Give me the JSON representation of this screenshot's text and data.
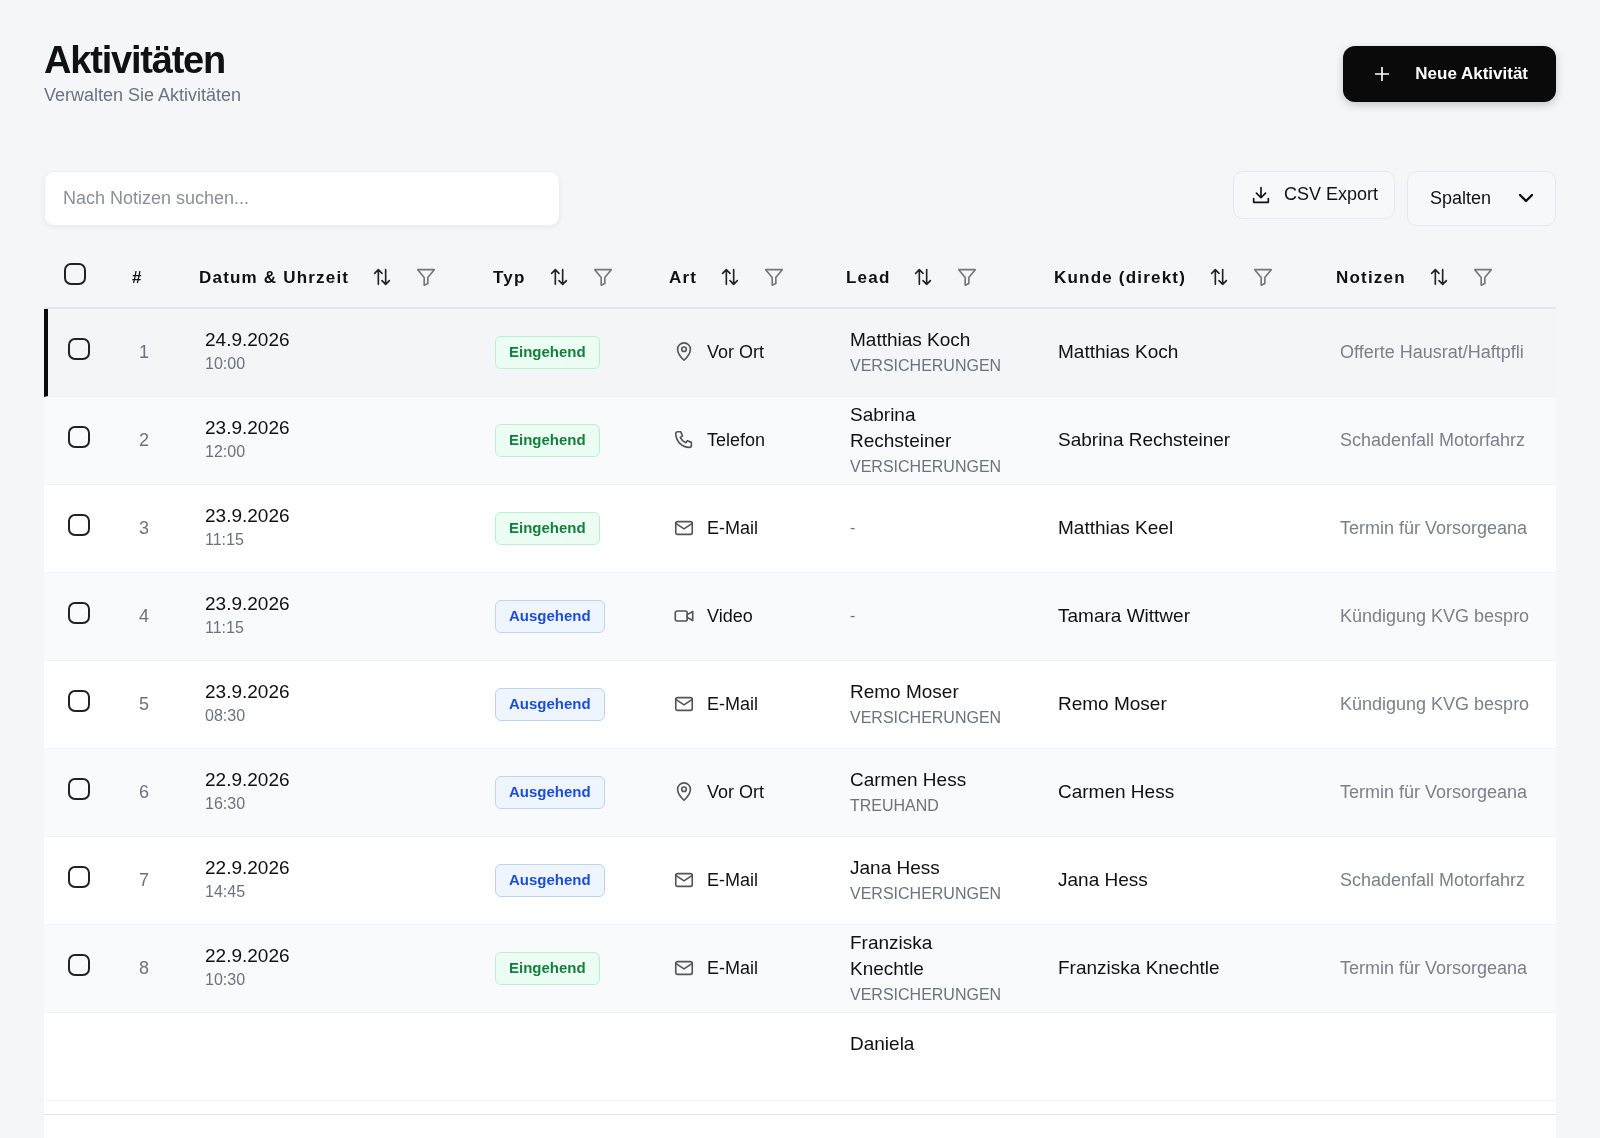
{
  "header": {
    "title": "Aktivitäten",
    "subtitle": "Verwalten Sie Aktivitäten",
    "new_button": "Neue Aktivität"
  },
  "toolbar": {
    "search": {
      "placeholder": "Nach Notizen suchen..."
    },
    "export_button": "CSV Export",
    "columns_button": "Spalten"
  },
  "table": {
    "select_all": {
      "checked": false
    },
    "columns": [
      {
        "label": "#",
        "sortable": false
      },
      {
        "label": "Datum & Uhrzeit",
        "sortable": true
      },
      {
        "label": "Typ",
        "sortable": true
      },
      {
        "label": "Art",
        "sortable": true
      },
      {
        "label": "Lead",
        "sortable": true
      },
      {
        "label": "Kunde (direkt)",
        "sortable": true
      },
      {
        "label": "Notizen",
        "sortable": true
      }
    ],
    "rows": [
      {
        "active": true,
        "checked": false,
        "number": "1",
        "date": "24.9.2026",
        "time": "10:00",
        "typ": {
          "label": "Eingehend",
          "kind": "in"
        },
        "art": {
          "label": "Vor Ort",
          "kind": "onsite"
        },
        "lead": {
          "name": "Matthias Koch",
          "company": "VERSICHERUNGEN"
        },
        "kunde": "Matthias Koch",
        "notes": "Offerte Hausrat/Haftpfli"
      },
      {
        "active": false,
        "checked": false,
        "number": "2",
        "date": "23.9.2026",
        "time": "12:00",
        "typ": {
          "label": "Eingehend",
          "kind": "in"
        },
        "art": {
          "label": "Telefon",
          "kind": "phone"
        },
        "lead": {
          "name": "Sabrina Rechsteiner",
          "company": "VERSICHERUNGEN"
        },
        "kunde": "Sabrina Rechsteiner",
        "notes": "Schadenfall Motorfahrz"
      },
      {
        "active": false,
        "checked": false,
        "number": "3",
        "date": "23.9.2026",
        "time": "11:15",
        "typ": {
          "label": "Eingehend",
          "kind": "in"
        },
        "art": {
          "label": "E-Mail",
          "kind": "mail"
        },
        "lead": {
          "name": "-"
        },
        "kunde": "Matthias Keel",
        "notes": "Termin für Vorsorgeana"
      },
      {
        "active": false,
        "checked": false,
        "number": "4",
        "date": "23.9.2026",
        "time": "11:15",
        "typ": {
          "label": "Ausgehend",
          "kind": "out"
        },
        "art": {
          "label": "Video",
          "kind": "video"
        },
        "lead": {
          "name": "-"
        },
        "kunde": "Tamara Wittwer",
        "notes": "Kündigung KVG bespro"
      },
      {
        "active": false,
        "checked": false,
        "number": "5",
        "date": "23.9.2026",
        "time": "08:30",
        "typ": {
          "label": "Ausgehend",
          "kind": "out"
        },
        "art": {
          "label": "E-Mail",
          "kind": "mail"
        },
        "lead": {
          "name": "Remo Moser",
          "company": "VERSICHERUNGEN"
        },
        "kunde": "Remo Moser",
        "notes": "Kündigung KVG bespro"
      },
      {
        "active": false,
        "checked": false,
        "number": "6",
        "date": "22.9.2026",
        "time": "16:30",
        "typ": {
          "label": "Ausgehend",
          "kind": "out"
        },
        "art": {
          "label": "Vor Ort",
          "kind": "onsite"
        },
        "lead": {
          "name": "Carmen Hess",
          "company": "TREUHAND"
        },
        "kunde": "Carmen Hess",
        "notes": "Termin für Vorsorgeana"
      },
      {
        "active": false,
        "checked": false,
        "number": "7",
        "date": "22.9.2026",
        "time": "14:45",
        "typ": {
          "label": "Ausgehend",
          "kind": "out"
        },
        "art": {
          "label": "E-Mail",
          "kind": "mail"
        },
        "lead": {
          "name": "Jana Hess",
          "company": "VERSICHERUNGEN"
        },
        "kunde": "Jana Hess",
        "notes": "Schadenfall Motorfahrz"
      },
      {
        "active": false,
        "checked": false,
        "number": "8",
        "date": "22.9.2026",
        "time": "10:30",
        "typ": {
          "label": "Eingehend",
          "kind": "in"
        },
        "art": {
          "label": "E-Mail",
          "kind": "mail"
        },
        "lead": {
          "name": "Franziska Knechtle",
          "company": "VERSICHERUNGEN"
        },
        "kunde": "Franziska Knechtle",
        "notes": "Termin für Vorsorgeana"
      },
      {
        "lead": {
          "name": "Daniela"
        }
      }
    ]
  }
}
